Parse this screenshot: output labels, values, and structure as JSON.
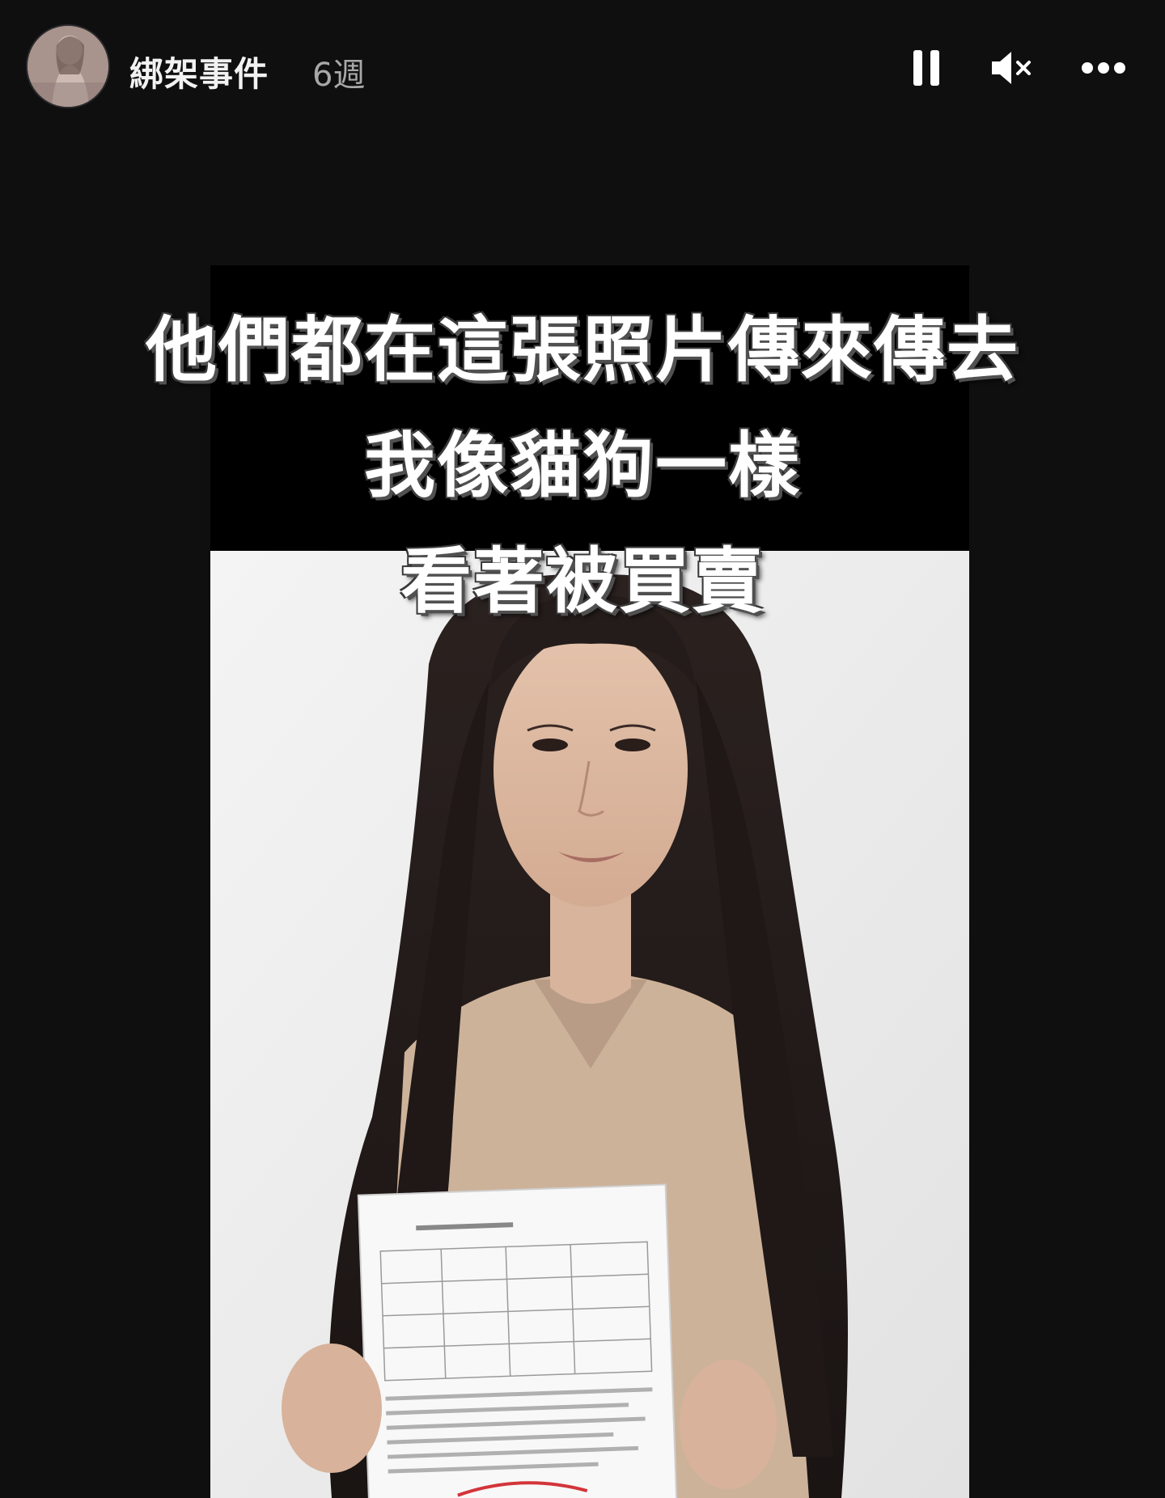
{
  "header": {
    "username": "綁架事件",
    "timestamp": "6週",
    "avatar_icon": "profile-avatar",
    "controls": {
      "pause_icon": "pause-icon",
      "mute_icon": "volume-muted-icon",
      "more_icon": "more-options-icon"
    }
  },
  "story": {
    "caption_lines": [
      "他們都在這張照片傳來傳去",
      "我像貓狗一樣",
      "看著被買賣"
    ],
    "photo_description_icon": "photo-image"
  },
  "colors": {
    "background": "#0f0f10",
    "caption_text": "#ffffff",
    "timestamp": "#a8a8a8"
  }
}
